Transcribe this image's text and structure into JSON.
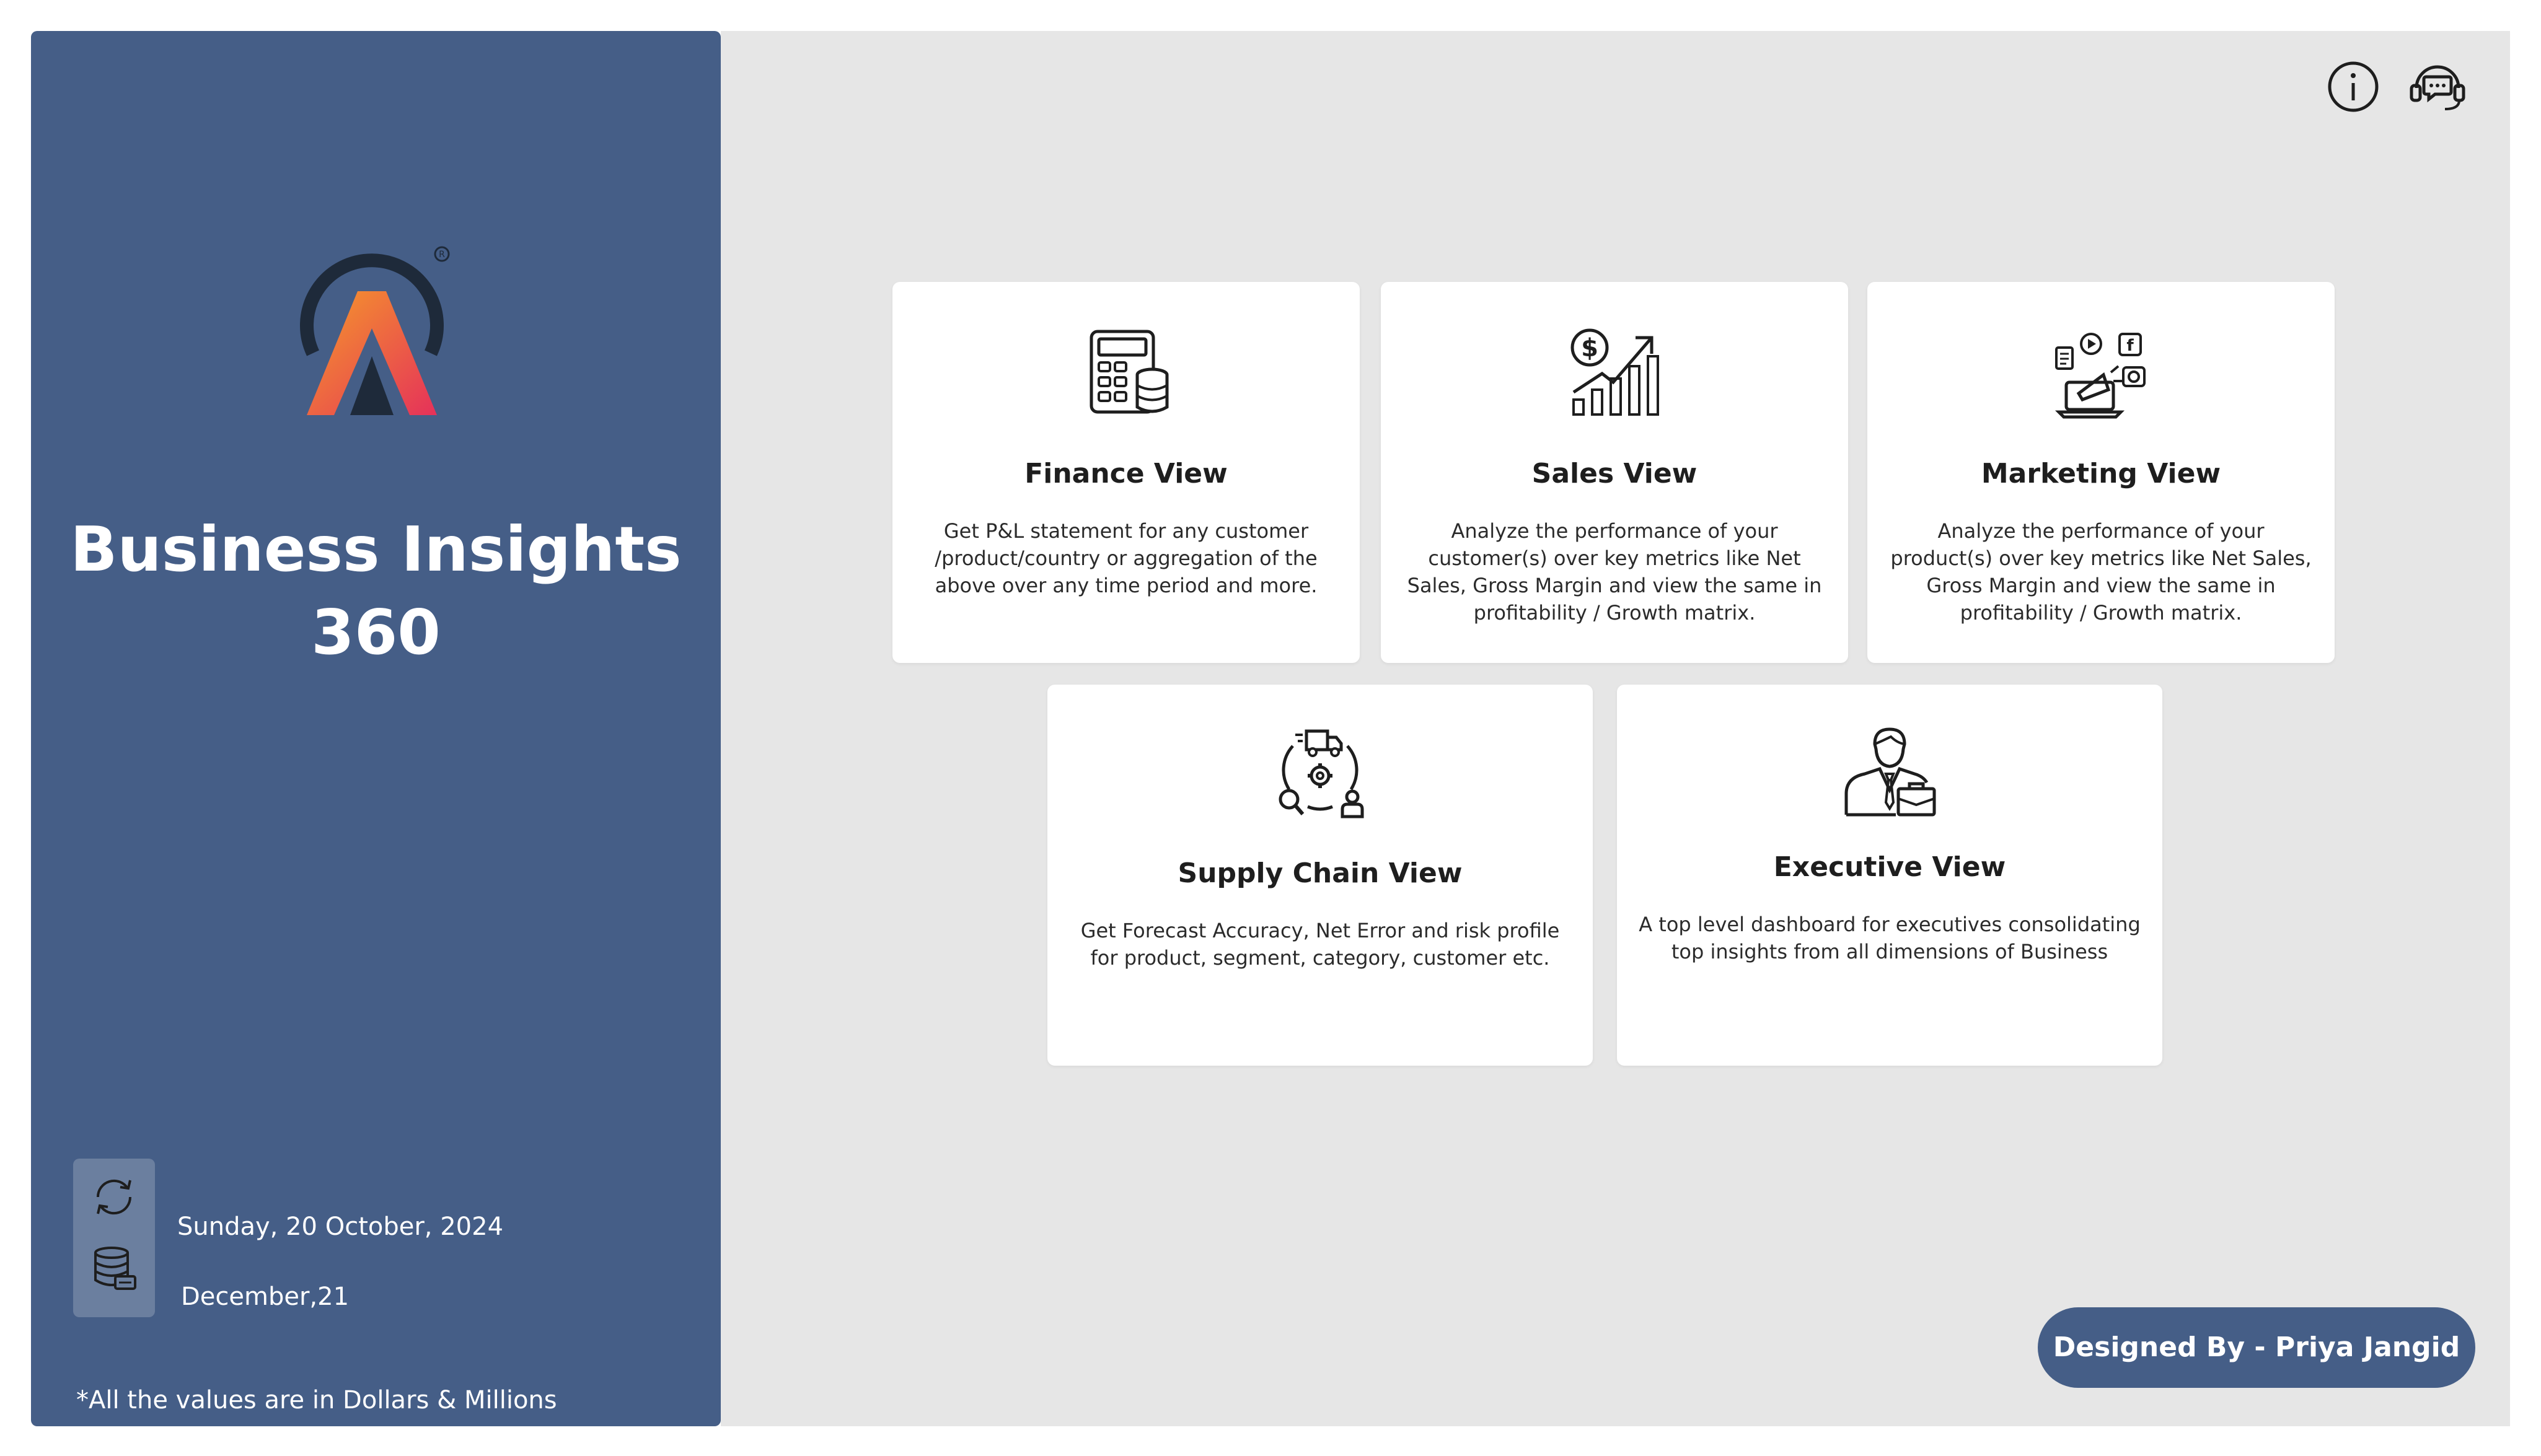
{
  "sidebar": {
    "title_line1": "Business Insights",
    "title_line2": "360",
    "refresh_date": "Sunday, 20 October, 2024",
    "data_period": "December,21",
    "footnote": "*All the values are in Dollars & Millions",
    "background_color": "#455e87"
  },
  "header": {
    "info_icon": "info-icon",
    "support_icon": "support-chat-icon"
  },
  "cards": [
    {
      "icon": "calculator-coins-icon",
      "title": "Finance View",
      "description": "Get P&L statement for any customer /product/country or aggregation of the above over any time period and more."
    },
    {
      "icon": "dollar-growth-chart-icon",
      "title": "Sales View",
      "description": "Analyze the performance of your customer(s) over key metrics like Net Sales, Gross Margin and view the same in profitability / Growth matrix."
    },
    {
      "icon": "digital-marketing-icon",
      "title": "Marketing View",
      "description": "Analyze the performance of your product(s) over key metrics like Net Sales, Gross Margin and view the same in profitability / Growth matrix."
    },
    {
      "icon": "supply-chain-icon",
      "title": "Supply Chain View",
      "description": "Get Forecast Accuracy, Net Error and risk profile for product, segment, category, customer etc."
    },
    {
      "icon": "executive-businessman-icon",
      "title": "Executive View",
      "description": "A top level dashboard for executives consolidating top insights from all dimensions of Business"
    }
  ],
  "footer": {
    "designed_by": "Designed By - Priya Jangid"
  },
  "colors": {
    "accent": "#455e87",
    "canvas": "#e6e6e6",
    "logo_orange": "#f37a2c",
    "logo_red": "#e5315a",
    "logo_dark": "#1e2a3a"
  }
}
